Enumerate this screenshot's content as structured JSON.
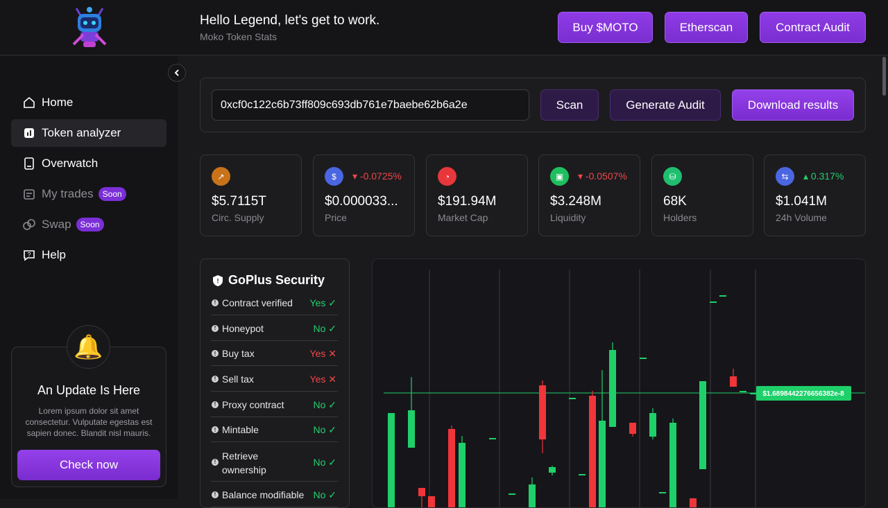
{
  "header": {
    "greeting": "Hello Legend, let's get to work.",
    "subtitle": "Moko Token Stats",
    "buttons": [
      "Buy $MOTO",
      "Etherscan",
      "Contract Audit"
    ]
  },
  "sidebar": {
    "items": [
      {
        "label": "Home",
        "icon": "home-icon"
      },
      {
        "label": "Token analyzer",
        "icon": "chart-icon",
        "active": true
      },
      {
        "label": "Overwatch",
        "icon": "wallet-icon"
      },
      {
        "label": "My trades",
        "icon": "trades-icon",
        "badge": "Soon"
      },
      {
        "label": "Swap",
        "icon": "swap-icon",
        "badge": "Soon"
      },
      {
        "label": "Help",
        "icon": "help-icon"
      }
    ],
    "update": {
      "title": "An Update Is Here",
      "text": "Lorem ipsum dolor sit amet consectetur. Vulputate egestas est sapien donec. Blandit nisl mauris.",
      "button": "Check now"
    }
  },
  "scanner": {
    "address": "0xcf0c122c6b73ff809c693db761e7baebe62b6a2e",
    "buttons": [
      "Scan",
      "Generate Audit",
      "Download results"
    ]
  },
  "stats": [
    {
      "value": "$5.7115T",
      "label": "Circ. Supply",
      "icon_color": "#c8731a"
    },
    {
      "value": "$0.000033...",
      "label": "Price",
      "change": "-0.0725%",
      "dir": "down",
      "icon_color": "#4a66e0"
    },
    {
      "value": "$191.94M",
      "label": "Market Cap",
      "icon_color": "#e8373b"
    },
    {
      "value": "$3.248M",
      "label": "Liquidity",
      "change": "-0.0507%",
      "dir": "down",
      "icon_color": "#1fbf5f"
    },
    {
      "value": "68K",
      "label": "Holders",
      "icon_color": "#1fbf6f"
    },
    {
      "value": "$1.041M",
      "label": "24h Volume",
      "change": "0.317%",
      "dir": "up",
      "icon_color": "#4a66e0"
    }
  ],
  "security": {
    "title": "GoPlus Security",
    "rows": [
      {
        "name": "Contract verified",
        "result": "Yes",
        "ok": true
      },
      {
        "name": "Honeypot",
        "result": "No",
        "ok": true
      },
      {
        "name": "Buy tax",
        "result": "Yes",
        "ok": false
      },
      {
        "name": "Sell tax",
        "result": "Yes",
        "ok": false
      },
      {
        "name": "Proxy contract",
        "result": "No",
        "ok": true
      },
      {
        "name": "Mintable",
        "result": "No",
        "ok": true
      },
      {
        "name": "Retrieve ownership",
        "result": "No",
        "ok": true
      },
      {
        "name": "Balance modifiable",
        "result": "No",
        "ok": true
      }
    ]
  },
  "chart": {
    "price_label": "$1.6898442276656382e-8",
    "colors": {
      "up": "#1fd06a",
      "down": "#f0353b"
    }
  }
}
